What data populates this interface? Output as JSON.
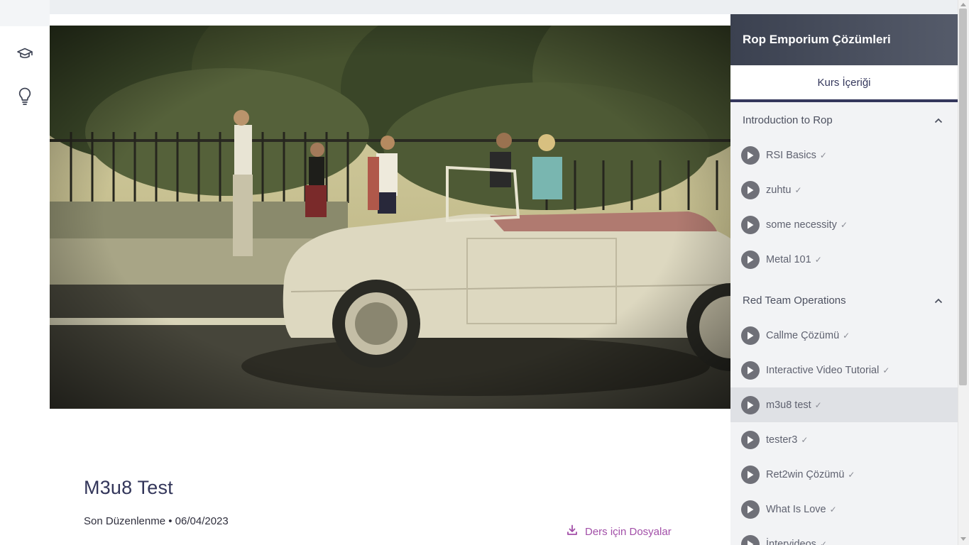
{
  "course": {
    "title": "Rop Emporium Çözümleri",
    "tab_label": "Kurs İçeriği"
  },
  "lesson": {
    "title": "M3u8 Test",
    "meta": "Son Düzenlenme • 06/04/2023",
    "files_label": "Ders için Dosyalar"
  },
  "rail": {
    "items": [
      {
        "icon": "graduation-cap-icon"
      },
      {
        "icon": "lightbulb-icon"
      }
    ]
  },
  "sections": [
    {
      "title": "Introduction to Rop",
      "items": [
        {
          "label": "RSI Basics"
        },
        {
          "label": "zuhtu"
        },
        {
          "label": "some necessity"
        },
        {
          "label": "Metal 101"
        }
      ]
    },
    {
      "title": "Red Team Operations",
      "items": [
        {
          "label": "Callme Çözümü"
        },
        {
          "label": "Interactive Video Tutorial"
        },
        {
          "label": "m3u8 test",
          "active": true
        },
        {
          "label": "tester3"
        },
        {
          "label": "Ret2win Çözümü"
        },
        {
          "label": "What Is Love"
        },
        {
          "label": "İntervideos"
        }
      ]
    }
  ],
  "colors": {
    "accent": "#34375c",
    "link": "#a24fa8",
    "header_gradient_start": "#3b4150",
    "header_gradient_end": "#555b6a"
  }
}
